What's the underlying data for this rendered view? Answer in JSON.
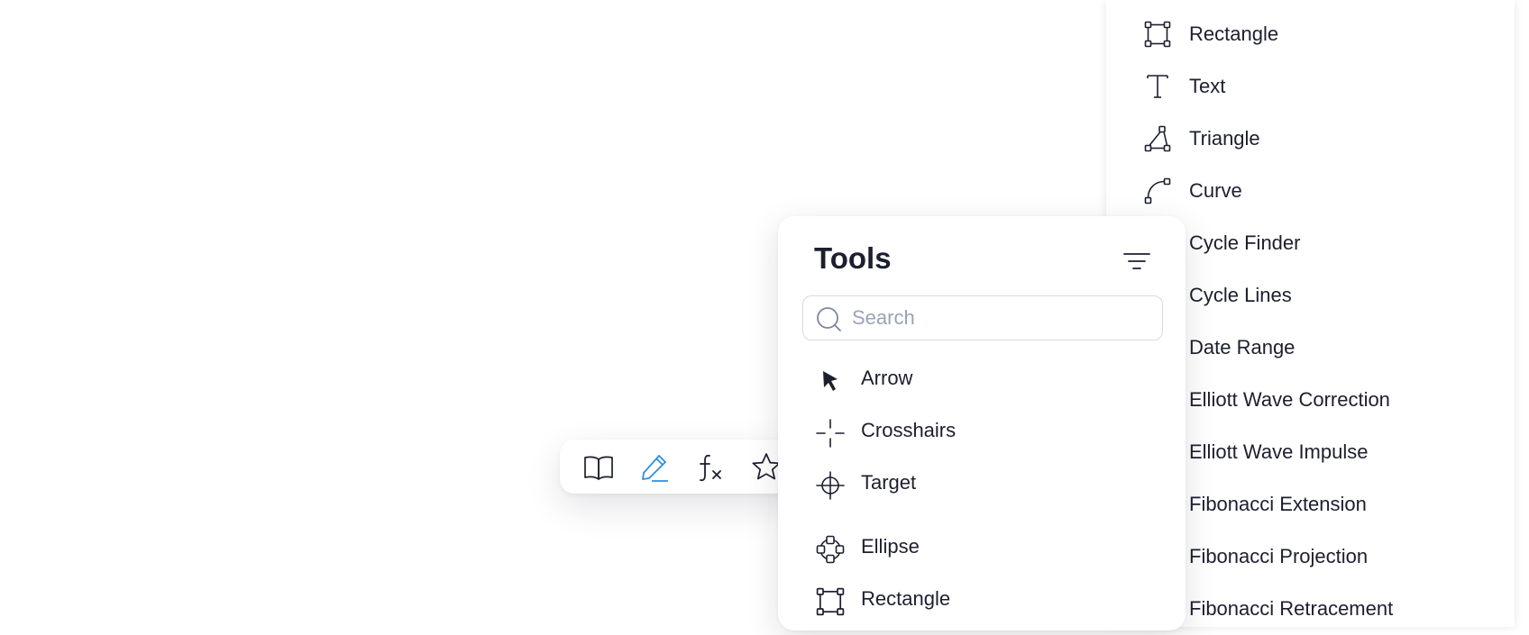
{
  "background_list": {
    "items": [
      {
        "label": "Rectangle",
        "icon": "rectangle-icon"
      },
      {
        "label": "Text",
        "icon": "text-icon"
      },
      {
        "label": "Triangle",
        "icon": "triangle-icon"
      },
      {
        "label": "Curve",
        "icon": "curve-icon"
      },
      {
        "label": "Cycle Finder",
        "icon": ""
      },
      {
        "label": "Cycle Lines",
        "icon": ""
      },
      {
        "label": "Date Range",
        "icon": ""
      },
      {
        "label": "Elliott Wave Correction",
        "icon": ""
      },
      {
        "label": "Elliott Wave Impulse",
        "icon": ""
      },
      {
        "label": "Fibonacci Extension",
        "icon": ""
      },
      {
        "label": "Fibonacci Projection",
        "icon": ""
      },
      {
        "label": "Fibonacci Retracement",
        "icon": ""
      }
    ]
  },
  "toolbar": {
    "buttons": [
      {
        "icon": "book-icon",
        "active": false
      },
      {
        "icon": "pen-icon",
        "active": true
      },
      {
        "icon": "function-icon",
        "active": false
      },
      {
        "icon": "star-icon",
        "active": false
      }
    ],
    "active_color": "#2e8fdb"
  },
  "tools_panel": {
    "title": "Tools",
    "filter_icon": "filter-icon",
    "search": {
      "placeholder": "Search",
      "value": ""
    },
    "items": [
      {
        "label": "Arrow",
        "icon": "arrow-cursor-icon"
      },
      {
        "label": "Crosshairs",
        "icon": "crosshairs-icon"
      },
      {
        "label": "Target",
        "icon": "target-icon"
      },
      {
        "label": "Ellipse",
        "icon": "ellipse-icon"
      },
      {
        "label": "Rectangle",
        "icon": "rectangle-icon"
      }
    ]
  },
  "colors": {
    "text": "#1c1f2e",
    "muted": "#9aa3b8",
    "border": "#d6dae6",
    "accent": "#2e8fdb"
  }
}
